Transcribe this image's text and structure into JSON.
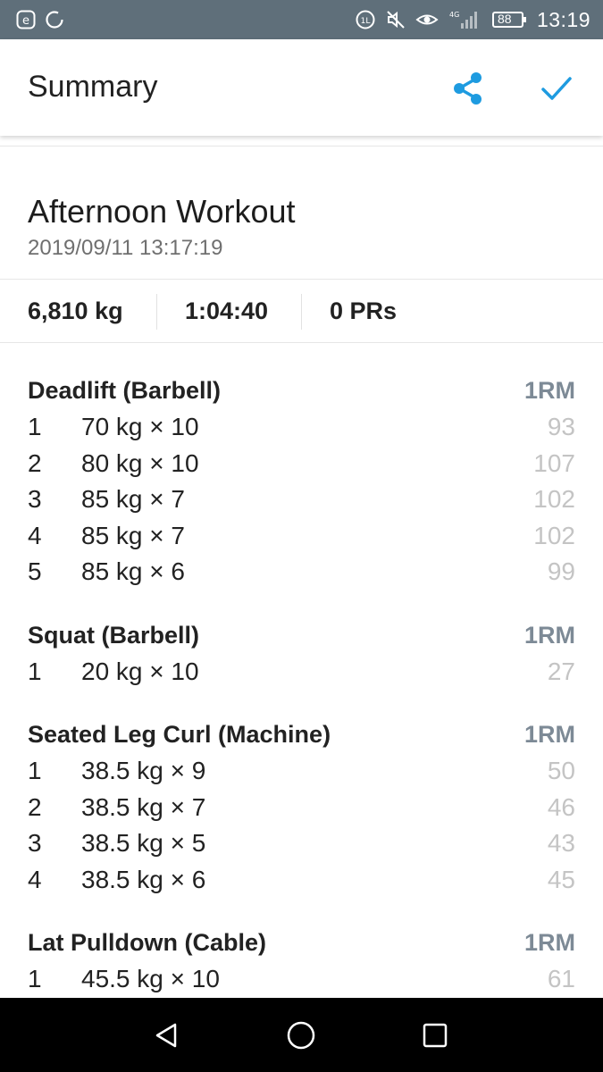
{
  "status_bar": {
    "time": "13:19",
    "battery": "88",
    "network": "4G",
    "icons_left": [
      "e-app-icon",
      "sync-icon"
    ],
    "icons_right": [
      "data-saver-icon",
      "mute-icon",
      "eye-comfort-icon",
      "signal-icon",
      "battery-icon"
    ]
  },
  "app_bar": {
    "title": "Summary",
    "accent": "#1e9be0",
    "actions": [
      "share-icon",
      "check-icon"
    ]
  },
  "workout": {
    "name": "Afternoon Workout",
    "datetime": "2019/09/11 13:17:19",
    "stats": {
      "volume": "6,810 kg",
      "duration": "1:04:40",
      "prs": "0 PRs"
    }
  },
  "exercises": [
    {
      "name": "Deadlift (Barbell)",
      "one_rm_label": "1RM",
      "sets": [
        {
          "n": "1",
          "desc": "70 kg × 10",
          "orm": "93"
        },
        {
          "n": "2",
          "desc": "80 kg × 10",
          "orm": "107"
        },
        {
          "n": "3",
          "desc": "85 kg × 7",
          "orm": "102"
        },
        {
          "n": "4",
          "desc": "85 kg × 7",
          "orm": "102"
        },
        {
          "n": "5",
          "desc": "85 kg × 6",
          "orm": "99"
        }
      ]
    },
    {
      "name": "Squat (Barbell)",
      "one_rm_label": "1RM",
      "sets": [
        {
          "n": "1",
          "desc": "20 kg × 10",
          "orm": "27"
        }
      ]
    },
    {
      "name": "Seated Leg Curl (Machine)",
      "one_rm_label": "1RM",
      "sets": [
        {
          "n": "1",
          "desc": "38.5 kg × 9",
          "orm": "50"
        },
        {
          "n": "2",
          "desc": "38.5 kg × 7",
          "orm": "46"
        },
        {
          "n": "3",
          "desc": "38.5 kg × 5",
          "orm": "43"
        },
        {
          "n": "4",
          "desc": "38.5 kg × 6",
          "orm": "45"
        }
      ]
    },
    {
      "name": "Lat Pulldown (Cable)",
      "one_rm_label": "1RM",
      "sets": [
        {
          "n": "1",
          "desc": "45.5 kg × 10",
          "orm": "61"
        }
      ]
    }
  ],
  "nav_bar": [
    "back-icon",
    "home-icon",
    "recents-icon"
  ]
}
